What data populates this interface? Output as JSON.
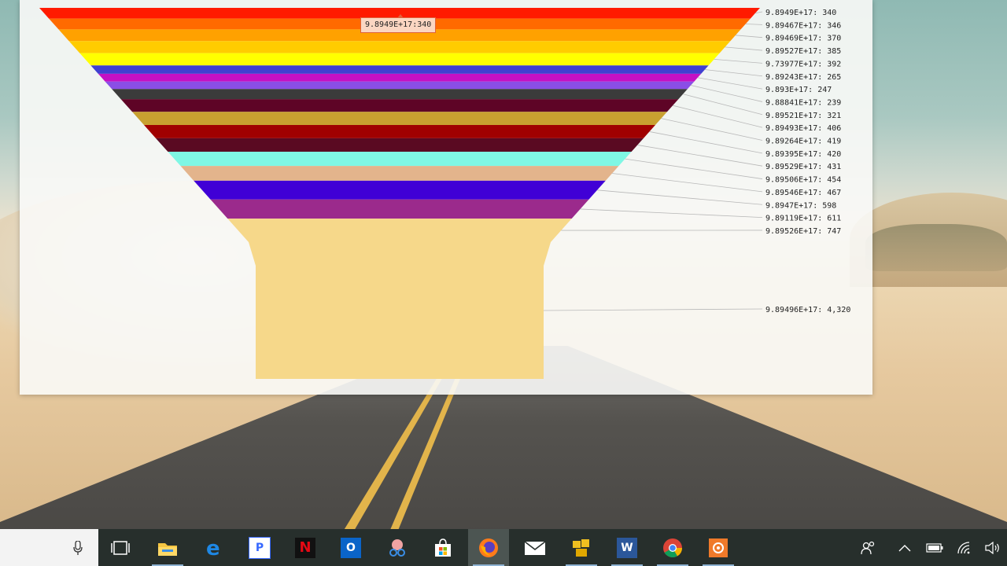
{
  "window": {
    "tooltip": "9.8949E+17:340"
  },
  "chart_data": {
    "type": "funnel",
    "categories": [
      "9.8949E+17",
      "9.89467E+17",
      "9.89469E+17",
      "9.89527E+17",
      "9.73977E+17",
      "9.89243E+17",
      "9.893E+17",
      "9.88841E+17",
      "9.89521E+17",
      "9.89493E+17",
      "9.89264E+17",
      "9.89395E+17",
      "9.89529E+17",
      "9.89506E+17",
      "9.89546E+17",
      "9.8947E+17",
      "9.89119E+17",
      "9.89526E+17",
      "9.89496E+17"
    ],
    "values": [
      340,
      346,
      370,
      385,
      392,
      265,
      247,
      239,
      321,
      406,
      419,
      420,
      431,
      454,
      467,
      598,
      611,
      747,
      4320
    ],
    "labels": [
      "9.8949E+17: 340",
      "9.89467E+17: 346",
      "9.89469E+17: 370",
      "9.89527E+17: 385",
      "9.73977E+17: 392",
      "9.89243E+17: 265",
      "9.893E+17: 247",
      "9.88841E+17: 239",
      "9.89521E+17: 321",
      "9.89493E+17: 406",
      "9.89264E+17: 419",
      "9.89395E+17: 420",
      "9.89529E+17: 431",
      "9.89506E+17: 454",
      "9.89546E+17: 467",
      "9.8947E+17: 598",
      "9.89119E+17: 611",
      "9.89526E+17: 747",
      "9.89496E+17: 4,320"
    ],
    "colors": [
      "#ff1a00",
      "#ff6a00",
      "#ffa100",
      "#ffcc00",
      "#ffff00",
      "#4040d0",
      "#c410c4",
      "#8a4ee6",
      "#3b3b3b",
      "#5e0426",
      "#c8a030",
      "#a00000",
      "#5a0a22",
      "#7ff7e4",
      "#e3b48c",
      "#4000d6",
      "#9b2a8c",
      "#f6d88a",
      "#f6d88a"
    ],
    "legend": "right"
  },
  "taskbar": {
    "apps": [
      {
        "name": "task-view",
        "glyph": "▭"
      },
      {
        "name": "file-explorer",
        "glyph": ""
      },
      {
        "name": "edge",
        "glyph": "e"
      },
      {
        "name": "pandora",
        "glyph": "P"
      },
      {
        "name": "netflix",
        "glyph": "N"
      },
      {
        "name": "outlook",
        "glyph": "O"
      },
      {
        "name": "snipping-tool",
        "glyph": "✂"
      },
      {
        "name": "store",
        "glyph": ""
      },
      {
        "name": "firefox",
        "glyph": ""
      },
      {
        "name": "mail",
        "glyph": "✉"
      },
      {
        "name": "app-yellow",
        "glyph": ""
      },
      {
        "name": "word",
        "glyph": "W"
      },
      {
        "name": "chrome",
        "glyph": ""
      },
      {
        "name": "app-orange",
        "glyph": ""
      }
    ]
  }
}
